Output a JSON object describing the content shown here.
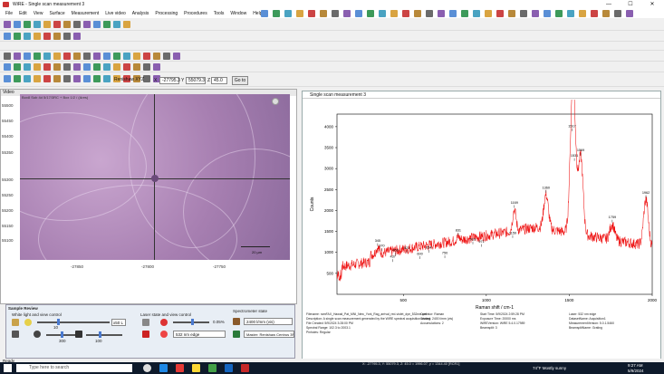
{
  "window": {
    "title": "WiRE - Single scan measurement 3"
  },
  "menu": [
    "File",
    "Edit",
    "View",
    "Surface",
    "Measurement",
    "Live video",
    "Analysis",
    "Processing",
    "Procedures",
    "Tools",
    "Window",
    "Help"
  ],
  "coords": {
    "label": "Renishaw XYZ",
    "x_label": "X",
    "x": "-27795.3",
    "y_label": "Y",
    "y": "55079.3",
    "z_label": "Z",
    "z": "45.0",
    "goto": "Go to"
  },
  "video": {
    "title": "Video",
    "overlay": "Box8 Sub 4d 5/17/3RC + Box 1/2 / (Ares)",
    "yticks": [
      "55500",
      "55450",
      "55400",
      "55350",
      "55300",
      "55250",
      "55200",
      "55150",
      "55100"
    ],
    "xticks": [
      "-27850",
      "-27800",
      "-27750"
    ],
    "scalebar": "20 µm"
  },
  "plot": {
    "title": "Single scan measurement 3",
    "ylabel": "Counts",
    "xlabel": "Raman shift / cm-1",
    "yticks": [
      "4000",
      "3500",
      "3000",
      "2500",
      "2000",
      "1500",
      "1000",
      "500"
    ],
    "xticks": [
      "500",
      "1000",
      "1500",
      "2000"
    ],
    "peaks": [
      {
        "label": "345",
        "x": 345,
        "y": 1110
      },
      {
        "label": "370",
        "x": 370,
        "y": 990
      },
      {
        "label": "437",
        "x": 437,
        "y": 730
      },
      {
        "label": "453",
        "x": 453,
        "y": 890
      },
      {
        "label": "521",
        "x": 521,
        "y": 940
      },
      {
        "label": "600",
        "x": 600,
        "y": 800
      },
      {
        "label": "654",
        "x": 654,
        "y": 950
      },
      {
        "label": "750",
        "x": 750,
        "y": 820
      },
      {
        "label": "831",
        "x": 831,
        "y": 1360
      },
      {
        "label": "919",
        "x": 919,
        "y": 1150
      },
      {
        "label": "971",
        "x": 971,
        "y": 1090
      },
      {
        "label": "1159",
        "x": 1159,
        "y": 1300
      },
      {
        "label": "1169",
        "x": 1169,
        "y": 2020
      },
      {
        "label": "1360",
        "x": 1360,
        "y": 2380
      },
      {
        "label": "1531",
        "x": 1531,
        "y": 3140
      },
      {
        "label": "1569",
        "x": 1569,
        "y": 3270
      },
      {
        "label": "1517",
        "x": 1517,
        "y": 3850
      },
      {
        "label": "1759",
        "x": 1759,
        "y": 1670
      },
      {
        "label": "1962",
        "x": 1962,
        "y": 2260
      }
    ]
  },
  "meta": {
    "left": [
      "Filename: ramFAX_Hawaii_Pat_MNI_New_York_Rag_arrival_red-violet_dye_532nm.wdf",
      "Description: A single scan measurement generated by the WiRE spectral acquisition wizard.",
      "File Created: 5/9/2024 3:28:00 PM",
      "Spectral Range: 102.3 to 2003.1",
      "Pinholes: Regular"
    ],
    "mid": [
      "Operator: Raman",
      "Grating: 2400 l/mm (vis)",
      "Accumulations: 2"
    ],
    "mid2": [
      "Start Time: 5/9/2024 2:59:28 PM",
      "Exposure Time: 20000 ms",
      "WiREVersion: WiRE 5.4.0.17989",
      "Beamsplit: 3"
    ],
    "right": [
      "Laser: 532 nm edge",
      "DatasetName: Acquisition1",
      "MeasurementVersion: 5.0.1.5460",
      "BeamsplitName: Grating"
    ]
  },
  "sample": {
    "title": "Sample Review",
    "white_light": "White light and view control",
    "laser_title": "Laser state and view control",
    "spectro_title": "Spectrometer state",
    "v1": "10",
    "v2": "300",
    "v3": "100",
    "lens": "x50 L",
    "laser_pct": "0.05%",
    "grating": "2400 l/mm (vis)",
    "laser": "532 nm edge",
    "master": "Master: Renishaw Centrus 3FS"
  },
  "taskbar": {
    "search": "Type here to search",
    "weather": "74°F Mostly sunny",
    "time": "9:27 AM",
    "date": "5/9/2024",
    "status": "Ready",
    "coordinfo": "X: -27795.3, Y: 55079.3, Z: 45.0 = 1996.07, y = 1344.40 [RCR1]"
  }
}
